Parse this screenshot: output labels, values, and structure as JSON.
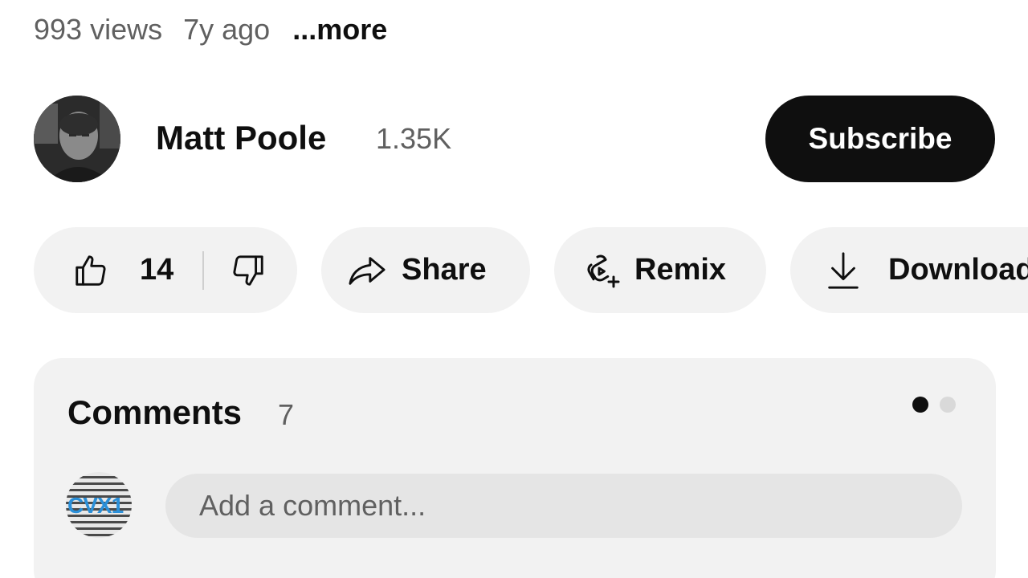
{
  "meta": {
    "views": "993 views",
    "ago": "7y ago",
    "more": "...more"
  },
  "channel": {
    "name": "Matt Poole",
    "subscribers": "1.35K",
    "subscribe_label": "Subscribe",
    "avatar_icon": "channel-avatar-photo"
  },
  "actions": {
    "like_count": "14",
    "like_icon": "thumbs-up-icon",
    "dislike_icon": "thumbs-down-icon",
    "share_label": "Share",
    "share_icon": "share-arrow-icon",
    "remix_label": "Remix",
    "remix_icon": "remix-icon",
    "download_label": "Download",
    "download_icon": "download-icon"
  },
  "comments": {
    "title": "Comments",
    "count": "7",
    "input_placeholder": "Add a comment...",
    "user_avatar_text": "CVX1"
  },
  "colors": {
    "primary_text": "#0f0f0f",
    "secondary_text": "#606060",
    "pill_bg": "#f2f2f2",
    "subscribe_bg": "#0f0f0f"
  }
}
